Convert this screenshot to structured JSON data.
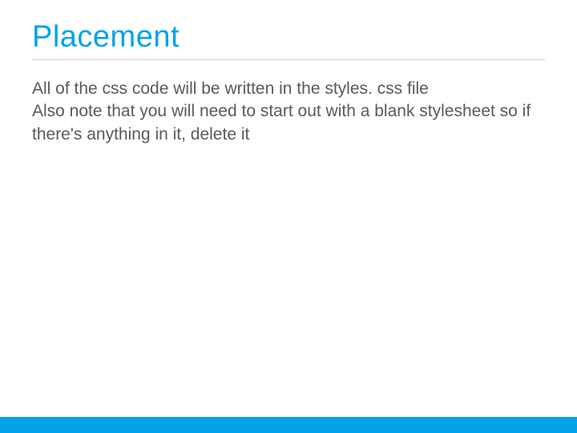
{
  "slide": {
    "title": "Placement",
    "body_line_1": "All of the css code will be written in the styles. css file",
    "body_line_2": "Also note that you will need to start out with a blank stylesheet so if there's anything in it, delete it"
  }
}
